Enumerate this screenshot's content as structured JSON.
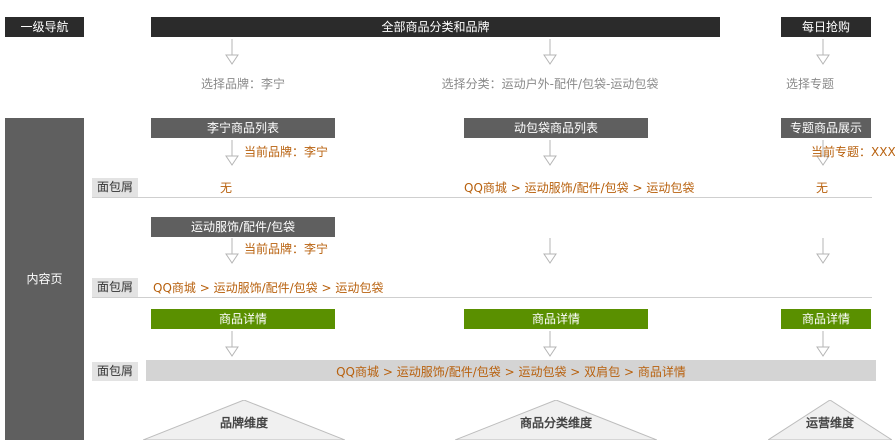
{
  "left": {
    "nav_label": "一级导航",
    "content_label": "内容页"
  },
  "top": {
    "all_categories": "全部商品分类和品牌",
    "daily_deals": "每日抢购",
    "select_brand": "选择品牌：李宁",
    "select_category": "选择分类：运动户外-配件/包袋-运动包袋",
    "select_topic": "选择专题"
  },
  "row1": {
    "brand_list": "李宁商品列表",
    "category_list": "动包袋商品列表",
    "topic_display": "专题商品展示",
    "current_brand": "当前品牌：李宁",
    "current_topic": "当前专题：XXX"
  },
  "breadcrumb_label": "面包屑",
  "crumb1": {
    "brand": "无",
    "category": [
      "QQ商城",
      "运动服饰/配件/包袋",
      "运动包袋"
    ],
    "topic": "无"
  },
  "row2": {
    "sub_category": "运动服饰/配件/包袋",
    "current_brand": "当前品牌：李宁"
  },
  "crumb2": [
    "QQ商城",
    "运动服饰/配件/包袋",
    "运动包袋"
  ],
  "row3": {
    "detail_label": "商品详情"
  },
  "crumb3": [
    "QQ商城",
    "运动服饰/配件/包袋",
    "运动包袋",
    "双肩包",
    "商品详情"
  ],
  "dimensions": {
    "brand": "品牌维度",
    "category": "商品分类维度",
    "operations": "运营维度"
  },
  "colors": {
    "dark": "#2b2b2b",
    "mid": "#5f5f5f",
    "green": "#5a9000",
    "orange": "#b8610e",
    "gray_text": "#8a8a8a"
  }
}
